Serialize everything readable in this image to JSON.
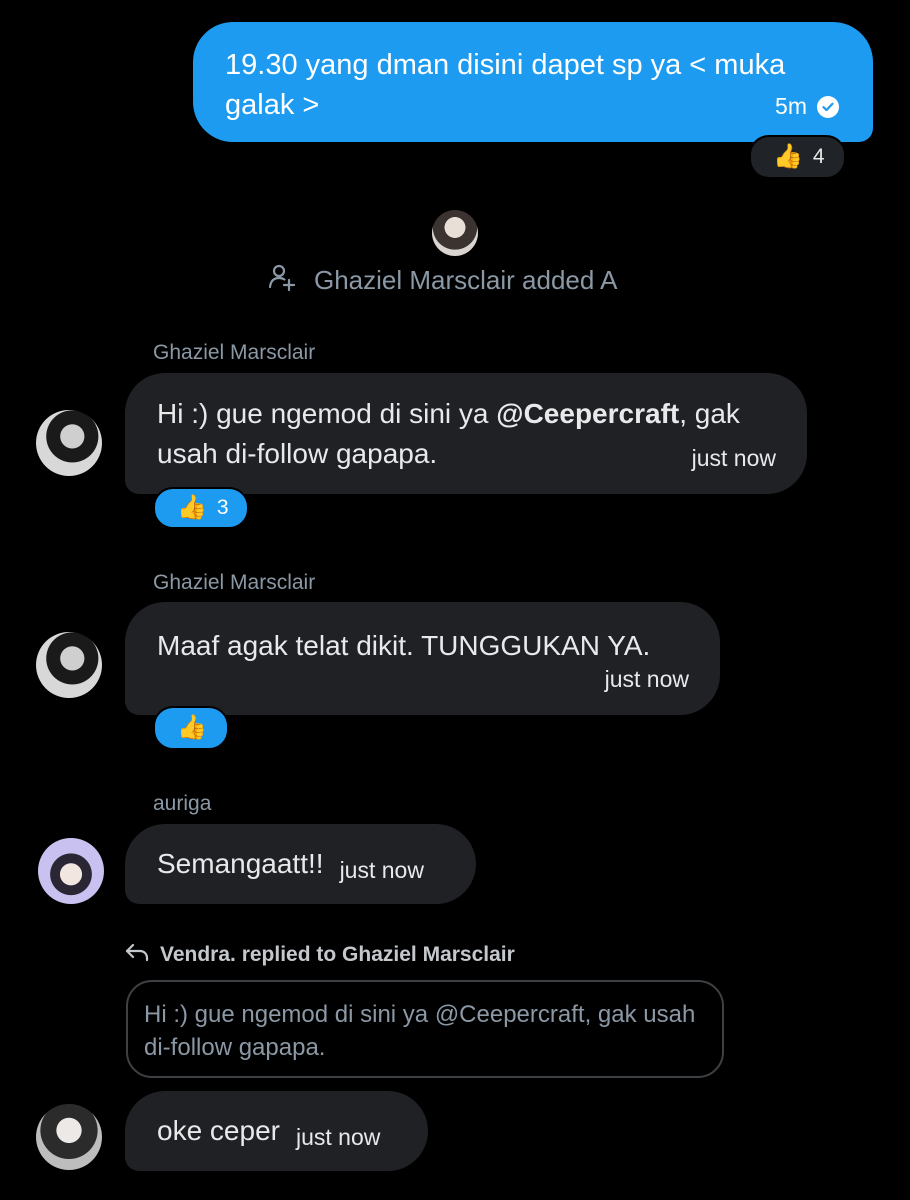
{
  "outgoing": {
    "text": "19.30 yang dman disini dapet sp ya < muka galak >",
    "time": "5m",
    "reaction": {
      "emoji": "👍",
      "count": "4"
    }
  },
  "system": {
    "text": "Ghaziel Marsclair added A"
  },
  "messages": [
    {
      "sender": "Ghaziel Marsclair",
      "text_before": "Hi :) gue ngemod di sini ya ",
      "mention": "@Ceepercraft",
      "text_after": ", gak usah di-follow gapapa.",
      "time": "just now",
      "reaction": {
        "emoji": "👍",
        "count": "3"
      }
    },
    {
      "sender": "Ghaziel Marsclair",
      "text": "Maaf agak telat dikit. TUNGGUKAN YA.",
      "time": "just now",
      "reaction": {
        "emoji": "👍"
      }
    },
    {
      "sender": "auriga",
      "text": "Semangaatt!!",
      "time": "just now"
    },
    {
      "reply_label": "Vendra. replied to Ghaziel Marsclair",
      "quoted_text": "Hi :) gue ngemod di sini ya @Ceepercraft, gak usah di-follow gapapa.",
      "text": "oke ceper",
      "time": "just now"
    }
  ],
  "colors": {
    "accent": "#1d9bf0",
    "background": "#000000",
    "bubble": "#1f2125",
    "muted": "#8b98a5"
  }
}
